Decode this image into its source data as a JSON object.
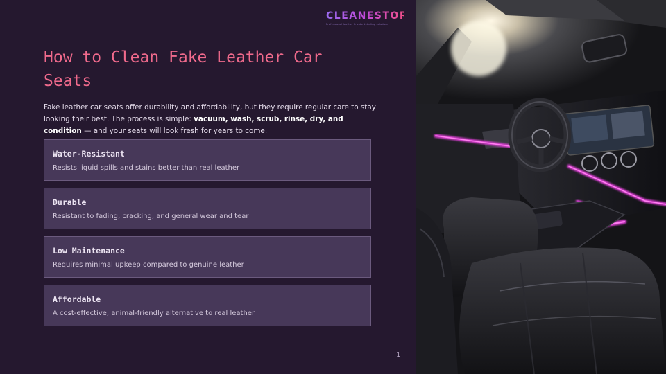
{
  "logo": {
    "name": "CLEANESTOR",
    "tagline": "Professional leather & auto detailing solutions"
  },
  "title": "How to Clean Fake Leather Car Seats",
  "intro": {
    "text_before": "Fake leather car seats offer durability and affordability, but they require regular care to stay looking their best. The process is simple: ",
    "bold": "vacuum, wash, scrub, rinse, dry, and condition",
    "text_after": " — and your seats will look fresh for years to come."
  },
  "features": [
    {
      "title": "Water-Resistant",
      "description": "Resists liquid spills and stains better than real leather"
    },
    {
      "title": "Durable",
      "description": "Resistant to fading, cracking, and general wear and tear"
    },
    {
      "title": "Low Maintenance",
      "description": "Requires minimal upkeep compared to genuine leather"
    },
    {
      "title": "Affordable",
      "description": "A cost-effective, animal-friendly alternative to real leather"
    }
  ],
  "page_number": "1",
  "colors": {
    "background": "#25182f",
    "title": "#f06a8c",
    "card": "#473859",
    "accent": "#e040d8"
  }
}
